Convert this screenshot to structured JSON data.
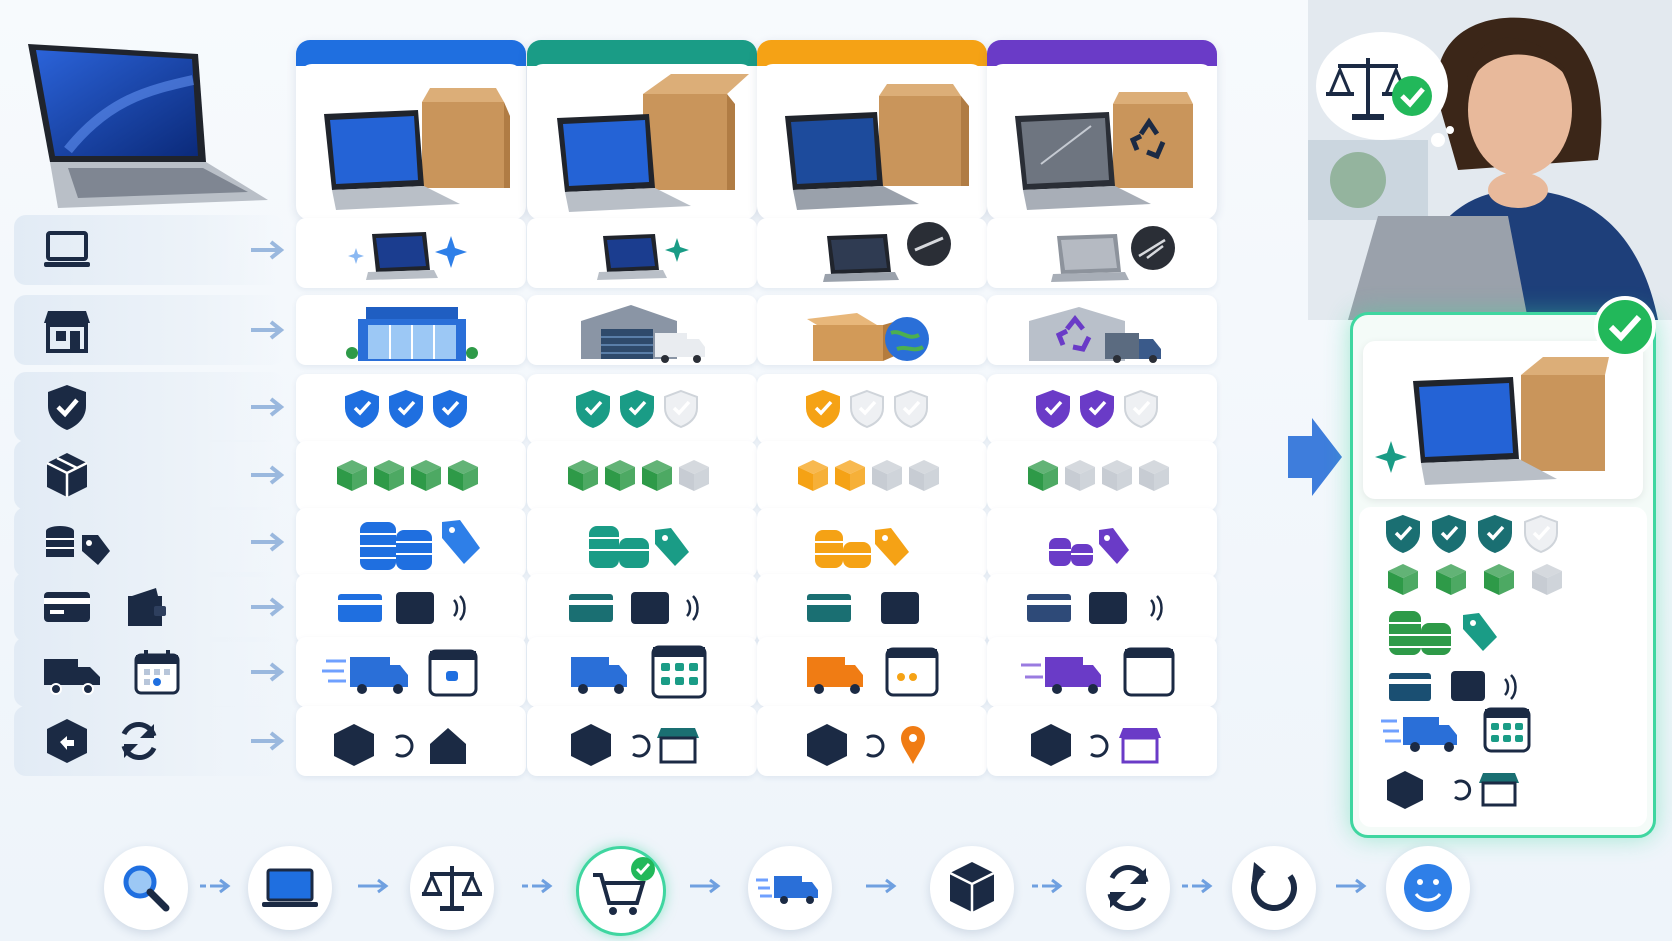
{
  "columns": [
    {
      "key": "new",
      "accent": "#1f6fe0"
    },
    {
      "key": "open_box",
      "accent": "#1a9c86"
    },
    {
      "key": "used",
      "accent": "#f5a215"
    },
    {
      "key": "refurbished",
      "accent": "#6a3bc7"
    }
  ],
  "legend_rows": [
    {
      "icon": "laptop-icon"
    },
    {
      "icon": "storefront-icon"
    },
    {
      "icon": "shield-check-icon"
    },
    {
      "icon": "package-icon"
    },
    {
      "icon": "coins-price-tag-icon"
    },
    {
      "icon": "card-wallet-icon"
    },
    {
      "icon": "truck-calendar-icon"
    },
    {
      "icon": "return-cycle-icon"
    }
  ],
  "ratings": {
    "warranty_shields": [
      3,
      2,
      1,
      2
    ],
    "condition_boxes": [
      4,
      3,
      2,
      1
    ],
    "recommended_shields": 3,
    "recommended_boxes": 3
  },
  "process_steps": [
    {
      "icon": "search-icon"
    },
    {
      "icon": "laptop-icon"
    },
    {
      "icon": "scale-icon"
    },
    {
      "icon": "cart-check-icon"
    },
    {
      "icon": "fast-truck-icon"
    },
    {
      "icon": "package-icon"
    },
    {
      "icon": "sync-icon"
    },
    {
      "icon": "refresh-icon"
    },
    {
      "icon": "smile-icon"
    }
  ],
  "colors": {
    "recommended": "#3fd6a0",
    "navy": "#1b2a44",
    "gray_box": "#c7ccd3"
  }
}
